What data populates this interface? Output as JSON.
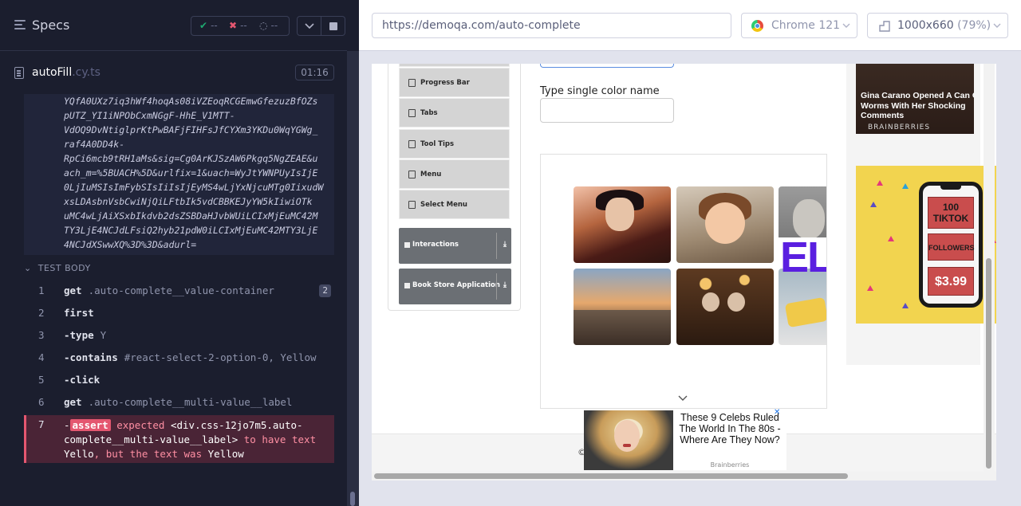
{
  "runner": {
    "header": {
      "title": "Specs"
    },
    "stats": {
      "passed_symbol": "✔",
      "passed": "--",
      "failed_symbol": "✖",
      "failed": "--",
      "pending": "--"
    },
    "spec": {
      "name": "autoFill",
      "ext": ".cy.ts",
      "duration": "01:16"
    },
    "url_log_lines": [
      "YQfA0UXz7iq3hWf4hoqAs08iVZEoqRCGEmwGfezuzBfOZs",
      "pUTZ_YI1iNPObCxmNGgF-HhE_V1MTT-",
      "VdOQ9DvNtiglprKtPwBAFjFIHFsJfCYXm3YKDu0WqYGWg_",
      "raf4A0DD4k-",
      "RpCi6mcb9tRH1aMs&sig=Cg0ArKJSzAW6Pkgq5NgZEAE&u",
      "ach_m=%5BUACH%5D&urlfix=1&uach=WyJtYWNPUyIsIjE",
      "0LjIuMSIsImFybSIsIiIsIjEyMS4wLjYxNjcuMTg0IixudW",
      "xsLDAsbnVsbCwiNjQiLFtbIk5vdCBBKEJyYW5kIiwiOTk",
      "uMC4wLjAiXSxbIkdvb2dsZSBDaHJvbWUiLCIxMjEuMC42M",
      "TY3LjE4NCJdLFsiQ2hyb21pdW0iLCIxMjEuMC42MTY3LjE",
      "4NCJdXSwwXQ%3D%3D&adurl="
    ],
    "test_body": {
      "label": "TEST BODY",
      "commands": [
        {
          "num": "1",
          "name": "get",
          "message": ".auto-complete__value-container",
          "badge": "2"
        },
        {
          "num": "2",
          "name": "first",
          "message": ""
        },
        {
          "num": "3",
          "name": "-type",
          "message": "Y"
        },
        {
          "num": "4",
          "name": "-contains",
          "message": "#react-select-2-option-0, Yellow"
        },
        {
          "num": "5",
          "name": "-click",
          "message": ""
        },
        {
          "num": "6",
          "name": "get",
          "message": ".auto-complete__multi-value__label"
        }
      ],
      "assert": {
        "num": "7",
        "prefix": "-",
        "tag": "assert",
        "expected_label": "expected",
        "subject": "<div.css-12jo7m5.auto-complete__multi-value__label>",
        "to_have_text": "to have text",
        "expected_value": "Yello",
        "but_text": ", but the text was",
        "actual_value": "Yellow"
      }
    }
  },
  "browser": {
    "url": "https://demoqa.com/auto-complete",
    "browser_name": "Chrome 121",
    "viewport": "1000x660",
    "zoom": "(79%)"
  },
  "aut": {
    "menu_items": [
      "Progress Bar",
      "Tabs",
      "Tool Tips",
      "Menu",
      "Select Menu"
    ],
    "groups": [
      "Interactions",
      "Book Store Application"
    ],
    "color_label": "Type single color name",
    "color_input_value": "",
    "ela_text": "ELA",
    "gina_ad": {
      "title": "Gina Carano Opened A Can Of Worms With Her Shocking Comments",
      "source": "BRAINBERRIES"
    },
    "tiktok_ad": {
      "line1": "100",
      "line2": "TIKTOK",
      "followers": "FOLLOWERS",
      "price": "$3.99"
    },
    "bottom_ad": {
      "title": "These 9 Celebs Ruled The World In The 80s - Where Are They Now?",
      "source": "Brainberries",
      "close": "✕"
    },
    "footer_left": "©",
    "footer_right": "."
  }
}
